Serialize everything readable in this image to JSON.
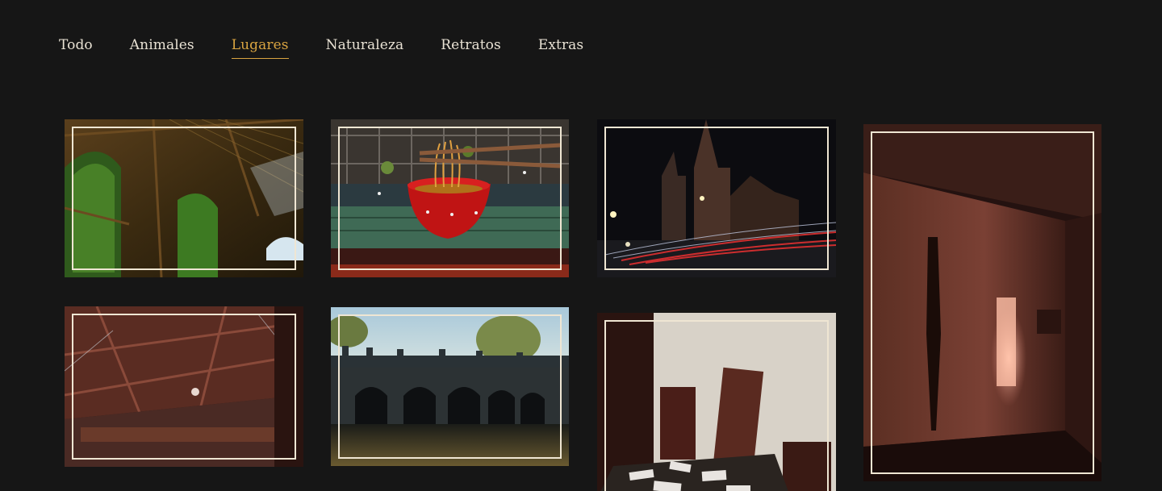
{
  "filters": {
    "tabs": [
      {
        "label": "Todo"
      },
      {
        "label": "Animales"
      },
      {
        "label": "Lugares"
      },
      {
        "label": "Naturaleza"
      },
      {
        "label": "Retratos"
      },
      {
        "label": "Extras"
      }
    ],
    "active": "Lugares"
  },
  "colors": {
    "background": "#161616",
    "nav_text": "#e9e2d4",
    "accent": "#d9a441",
    "frame": "#efe6d3"
  }
}
